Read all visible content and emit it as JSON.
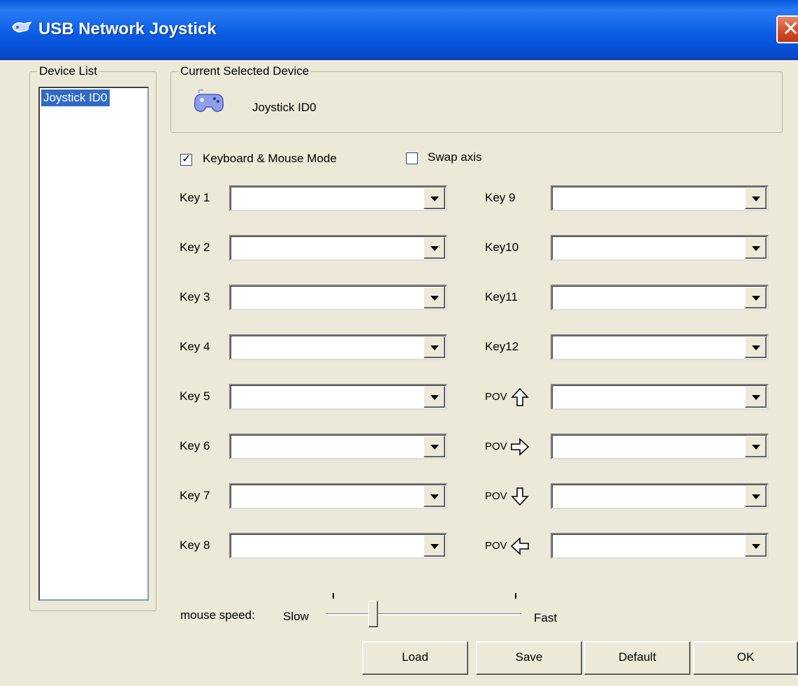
{
  "window": {
    "title": "USB Network Joystick",
    "close_label": "✕"
  },
  "device_list": {
    "label": "Device List",
    "items": [
      "Joystick ID0"
    ]
  },
  "current_device": {
    "label": "Current Selected Device",
    "name": "Joystick ID0"
  },
  "options": {
    "keyboard_mouse_mode": {
      "label": "Keyboard & Mouse Mode",
      "checked": true
    },
    "swap_axis": {
      "label": "Swap axis",
      "checked": false
    }
  },
  "keys_left": [
    {
      "label": "Key 1",
      "value": ""
    },
    {
      "label": "Key 2",
      "value": ""
    },
    {
      "label": "Key 3",
      "value": ""
    },
    {
      "label": "Key 4",
      "value": ""
    },
    {
      "label": "Key 5",
      "value": ""
    },
    {
      "label": "Key 6",
      "value": ""
    },
    {
      "label": "Key 7",
      "value": ""
    },
    {
      "label": "Key 8",
      "value": ""
    }
  ],
  "keys_right": [
    {
      "label": "Key 9",
      "value": ""
    },
    {
      "label": "Key10",
      "value": ""
    },
    {
      "label": "Key11",
      "value": ""
    },
    {
      "label": "Key12",
      "value": ""
    },
    {
      "label": "POV",
      "value": "",
      "arrow": "up-arrow-icon"
    },
    {
      "label": "POV",
      "value": "",
      "arrow": "right-arrow-icon"
    },
    {
      "label": "POV",
      "value": "",
      "arrow": "down-arrow-icon"
    },
    {
      "label": "POV",
      "value": "",
      "arrow": "left-arrow-icon"
    }
  ],
  "mouse_speed": {
    "label": "mouse speed:",
    "min_label": "Slow",
    "max_label": "Fast",
    "level": 0.2
  },
  "buttons": {
    "load": "Load",
    "save": "Save",
    "default": "Default",
    "ok": "OK"
  },
  "colors": {
    "titlebar": "#0c5fe4",
    "face": "#ece9d8",
    "selection": "#316ac5",
    "close": "#d04a25"
  }
}
